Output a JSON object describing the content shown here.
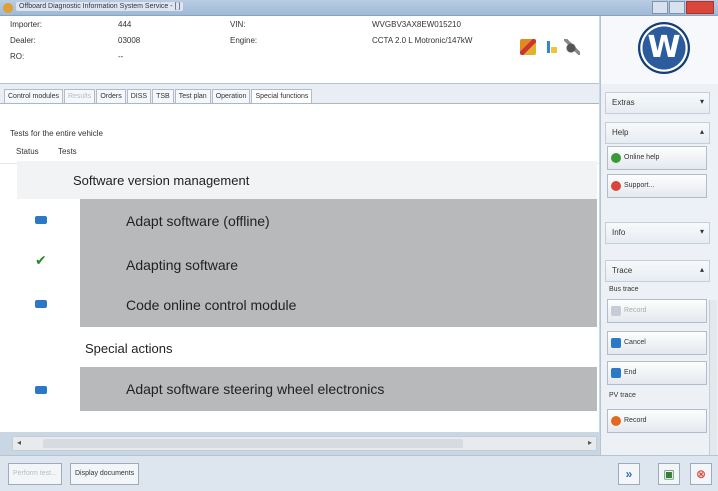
{
  "window": {
    "title": "Offboard Diagnostic Information System Service - [   ]"
  },
  "info": {
    "importer_label": "Importer:",
    "importer_value": "444",
    "dealer_label": "Dealer:",
    "dealer_value": "03008",
    "ro_label": "RO:",
    "ro_value": "--",
    "vin_label": "VIN:",
    "vin_value": "WVGBV3AX8EW015210",
    "engine_label": "Engine:",
    "engine_value": "CCTA 2.0 L Motronic/147kW"
  },
  "tabs": [
    {
      "label": "Control modules",
      "state": "normal"
    },
    {
      "label": "Results",
      "state": "disabled"
    },
    {
      "label": "Orders",
      "state": "normal"
    },
    {
      "label": "DISS",
      "state": "normal"
    },
    {
      "label": "TSB",
      "state": "normal"
    },
    {
      "label": "Test plan",
      "state": "normal"
    },
    {
      "label": "Operation",
      "state": "normal"
    },
    {
      "label": "Special functions",
      "state": "active"
    }
  ],
  "panel": {
    "label": "Tests for the entire vehicle",
    "col_status": "Status",
    "col_tests": "Tests",
    "group1": "Software version management",
    "item1": "Adapt software (offline)",
    "item2": "Adapting software",
    "item3": "Code online control module",
    "group2": "Special actions",
    "item4": "Adapt software steering wheel electronics"
  },
  "bottom": {
    "perform_test": "Perform test...",
    "display_documents": "Display documents"
  },
  "sidebar": {
    "extras": "Extras",
    "help": "Help",
    "online_help": "Online help",
    "support": "Support...",
    "info": "Info",
    "trace": "Trace",
    "bus_trace": "Bus trace",
    "record1": "Record",
    "cancel": "Cancel",
    "end": "End",
    "pv_trace": "PV trace",
    "record2": "Record"
  },
  "colors": {
    "accent": "#2b78c6",
    "item_bg": "#b7b9bb",
    "ok": "#2a8a2a",
    "exit": "#d9473a"
  },
  "icons": [
    "tools-icon",
    "usb-icon",
    "plug-icon",
    "vw-logo"
  ]
}
